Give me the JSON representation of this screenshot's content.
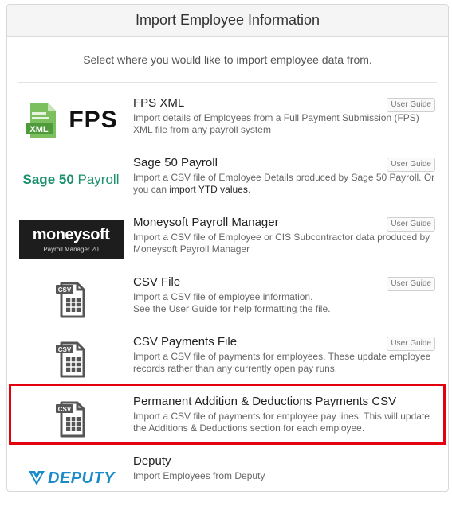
{
  "header": {
    "title": "Import Employee Information"
  },
  "subtitle": "Select where you would like to import employee data from.",
  "user_guide_label": "User Guide",
  "colors": {
    "highlight": "#e3000f",
    "sage_green": "#1a8f6b",
    "deputy_blue": "#1a8bc9",
    "fps_green": "#5fae46"
  },
  "options": [
    {
      "logo": "fps-xml-logo",
      "logo_text": "FPS",
      "logo_badge": "XML",
      "title": "FPS XML",
      "description": "Import details of Employees from a Full Payment Submission (FPS) XML file from any payroll system",
      "user_guide": true
    },
    {
      "logo": "sage-50-payroll-logo",
      "logo_text_bold": "Sage 50",
      "logo_text_regular": " Payroll",
      "title": "Sage 50 Payroll",
      "description_pre": "Import a CSV file of Employee Details produced by Sage 50 Payroll. Or you can ",
      "description_link": "import YTD values",
      "description_post": ".",
      "user_guide": true
    },
    {
      "logo": "moneysoft-logo",
      "logo_text": "moneysoft",
      "logo_sub": "Payroll Manager 20",
      "title": "Moneysoft Payroll Manager",
      "description": "Import a CSV file of Employee or CIS Subcontractor data produced by Moneysoft Payroll Manager",
      "user_guide": true
    },
    {
      "logo": "csv-file-icon",
      "logo_badge": "CSV",
      "title": "CSV File",
      "description_line1": "Import a CSV file of employee information.",
      "description_line2": "See the User Guide for help formatting the file.",
      "user_guide": true
    },
    {
      "logo": "csv-file-icon",
      "logo_badge": "CSV",
      "title": "CSV Payments File",
      "description": "Import a CSV file of payments for employees. These update employee records rather than any currently open pay runs.",
      "user_guide": true
    },
    {
      "logo": "csv-file-icon",
      "logo_badge": "CSV",
      "title": "Permanent Addition & Deductions Payments CSV",
      "description": "Import a CSV file of payments for employee pay lines. This will update the Additions & Deductions section for each employee.",
      "user_guide": false,
      "highlighted": true
    },
    {
      "logo": "deputy-logo",
      "logo_text": "DEPUTY",
      "title": "Deputy",
      "description": "Import Employees from Deputy",
      "user_guide": false
    }
  ]
}
